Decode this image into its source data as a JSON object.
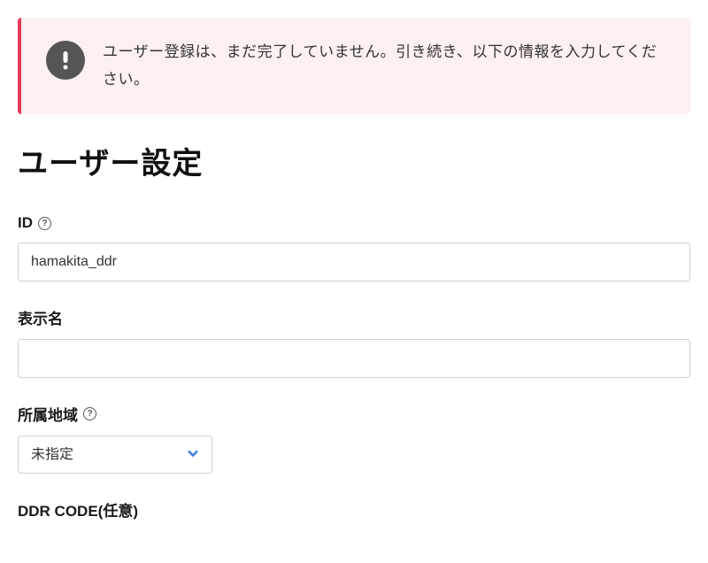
{
  "alert": {
    "message": "ユーザー登録は、まだ完了していません。引き続き、以下の情報を入力してください。"
  },
  "page": {
    "title": "ユーザー設定"
  },
  "form": {
    "id": {
      "label": "ID",
      "value": "hamakita_ddr"
    },
    "display_name": {
      "label": "表示名",
      "value": ""
    },
    "region": {
      "label": "所属地域",
      "selected": "未指定"
    },
    "ddr_code": {
      "label": "DDR CODE(任意)"
    }
  }
}
